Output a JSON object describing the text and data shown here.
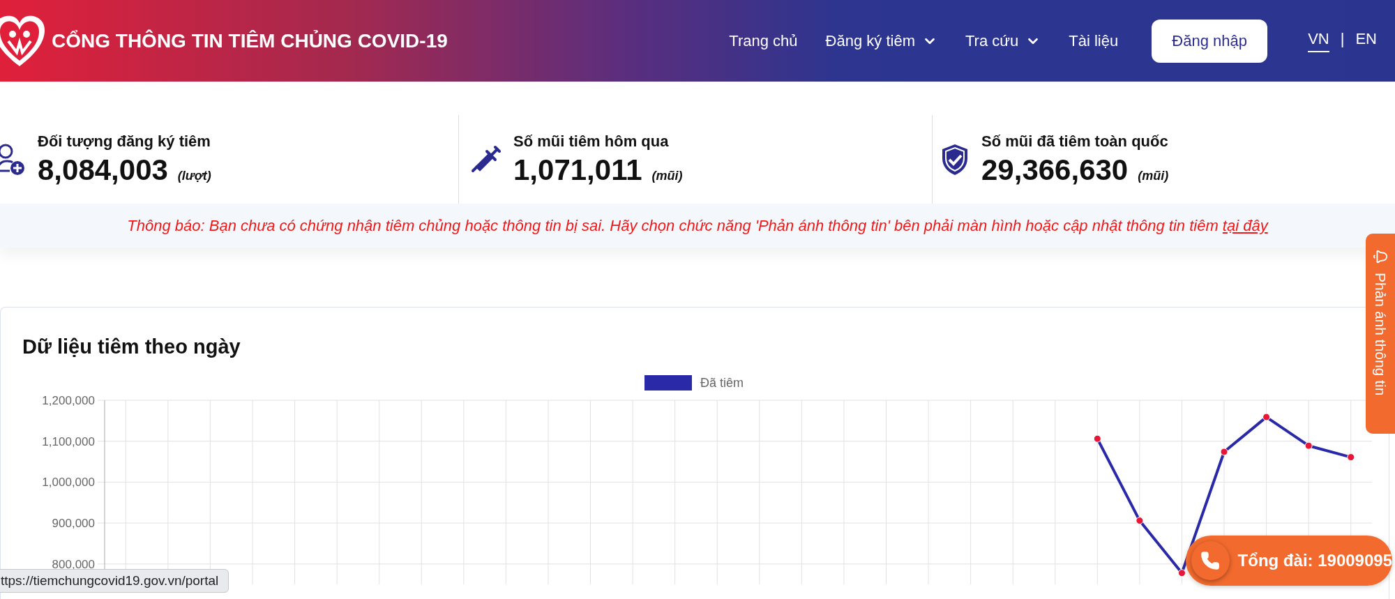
{
  "header": {
    "title": "CỔNG THÔNG TIN TIÊM CHỦNG COVID-19",
    "nav": [
      {
        "label": "Trang chủ",
        "dropdown": false
      },
      {
        "label": "Đăng ký tiêm",
        "dropdown": true
      },
      {
        "label": "Tra cứu",
        "dropdown": true
      },
      {
        "label": "Tài liệu",
        "dropdown": false
      }
    ],
    "login_button": "Đăng nhập",
    "languages": [
      {
        "label": "VN",
        "selected": true
      },
      {
        "label": "EN",
        "selected": false
      }
    ],
    "language_separator": "|"
  },
  "stats": [
    {
      "kind": "person",
      "label": "Đối tượng đăng ký tiêm",
      "value": "8,084,003",
      "unit": "(lượt)"
    },
    {
      "kind": "syringe",
      "label": "Số mũi tiêm hôm qua",
      "value": "1,071,011",
      "unit": "(mũi)"
    },
    {
      "kind": "shield",
      "label": "Số mũi đã tiêm toàn quốc",
      "value": "29,366,630",
      "unit": "(mũi)"
    }
  ],
  "notice": {
    "text": "Thông báo: Bạn chưa có chứng nhận tiêm chủng hoặc thông tin bị sai. Hãy chọn chức năng 'Phản ánh thông tin' bên phải màn hình hoặc cập nhật thông tin tiêm",
    "link": "tại đây"
  },
  "chart": {
    "title": "Dữ liệu tiêm theo ngày",
    "chart_data": {
      "type": "line",
      "grid": true,
      "series": [
        {
          "name": "Đã tiêm",
          "color": "#2a2aa8",
          "marker": "circle",
          "values": [
            null,
            null,
            null,
            null,
            null,
            null,
            null,
            null,
            null,
            null,
            null,
            null,
            null,
            null,
            null,
            null,
            null,
            null,
            null,
            null,
            null,
            null,
            null,
            1106000,
            906000,
            778000,
            1074000,
            1159000,
            1089000,
            1061000
          ]
        }
      ],
      "ylim": [
        750000,
        1200000
      ],
      "yticks": [
        {
          "value": 1200000,
          "label": "1,200,000"
        },
        {
          "value": 1100000,
          "label": "1,100,000"
        },
        {
          "value": 1000000,
          "label": "1,000,000"
        },
        {
          "value": 900000,
          "label": "900,000"
        },
        {
          "value": 800000,
          "label": "800,000"
        }
      ]
    }
  },
  "feedback_tab": {
    "label": "Phản ánh thông tin"
  },
  "hotline": {
    "label": "Tổng đài: 19009095"
  },
  "status_url": "ttps://tiemchungcovid19.gov.vn/portal"
}
